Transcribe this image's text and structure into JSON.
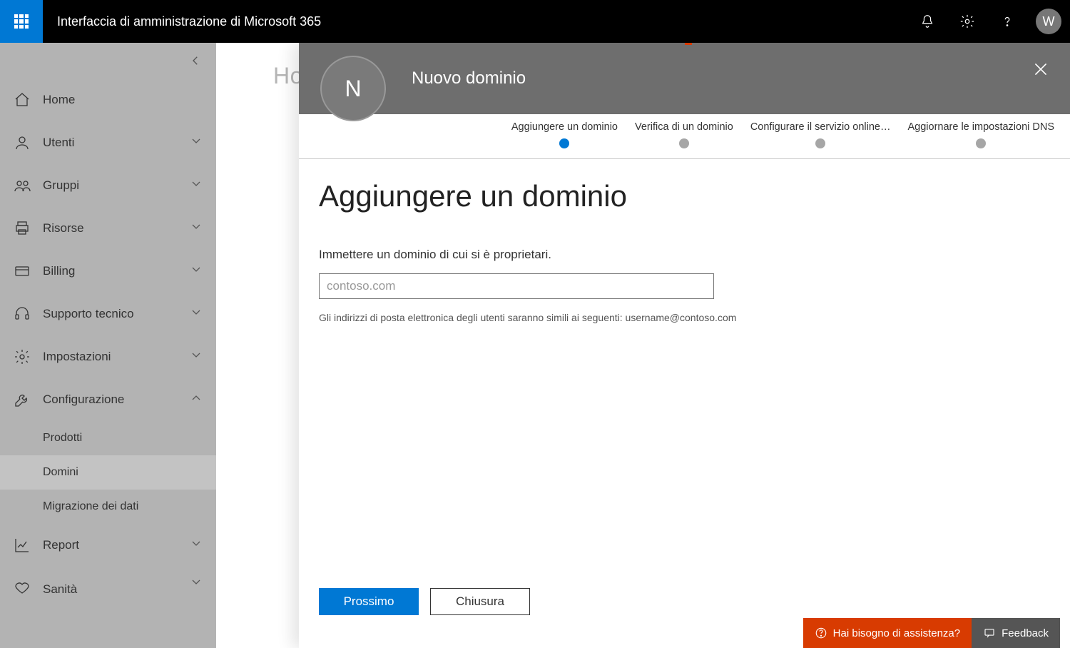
{
  "header": {
    "app_title": "Interfaccia di amministrazione di Microsoft 365",
    "avatar_letter": "W"
  },
  "breadcrumb_faded": "Hom",
  "sidebar": {
    "items": [
      {
        "label": "Home",
        "icon": "home-icon",
        "expandable": false
      },
      {
        "label": "Utenti",
        "icon": "user-icon",
        "expandable": true
      },
      {
        "label": "Gruppi",
        "icon": "groups-icon",
        "expandable": true
      },
      {
        "label": "Risorse",
        "icon": "printer-icon",
        "expandable": true
      },
      {
        "label": "Billing",
        "icon": "card-icon",
        "expandable": true
      },
      {
        "label": "Supporto tecnico",
        "icon": "headset-icon",
        "expandable": true
      },
      {
        "label": "Impostazioni",
        "icon": "gear-icon",
        "expandable": true
      },
      {
        "label": "Configurazione",
        "icon": "wrench-icon",
        "expandable": true,
        "expanded": true,
        "subitems": [
          "Prodotti",
          "Domini",
          "Migrazione dei dati"
        ],
        "active_sub": 1
      },
      {
        "label": "Report",
        "icon": "chart-icon",
        "expandable": true
      },
      {
        "label": "Sanità",
        "icon": "heart-icon",
        "expandable": true
      }
    ]
  },
  "panel": {
    "avatar_letter": "N",
    "title": "Nuovo dominio",
    "steps": [
      "Aggiungere un dominio",
      "Verifica di un dominio",
      "Configurare il servizio online…",
      "Aggiornare le impostazioni DNS"
    ],
    "active_step": 0,
    "heading": "Aggiungere un dominio",
    "lead": "Immettere un dominio di cui si è proprietari.",
    "input_placeholder": "contoso.com",
    "hint": "Gli indirizzi di posta elettronica degli utenti saranno simili ai seguenti: username@contoso.com",
    "buttons": {
      "primary": "Prossimo",
      "secondary": "Chiusura"
    }
  },
  "footer": {
    "help": "Hai bisogno di assistenza?",
    "feedback": "Feedback"
  }
}
